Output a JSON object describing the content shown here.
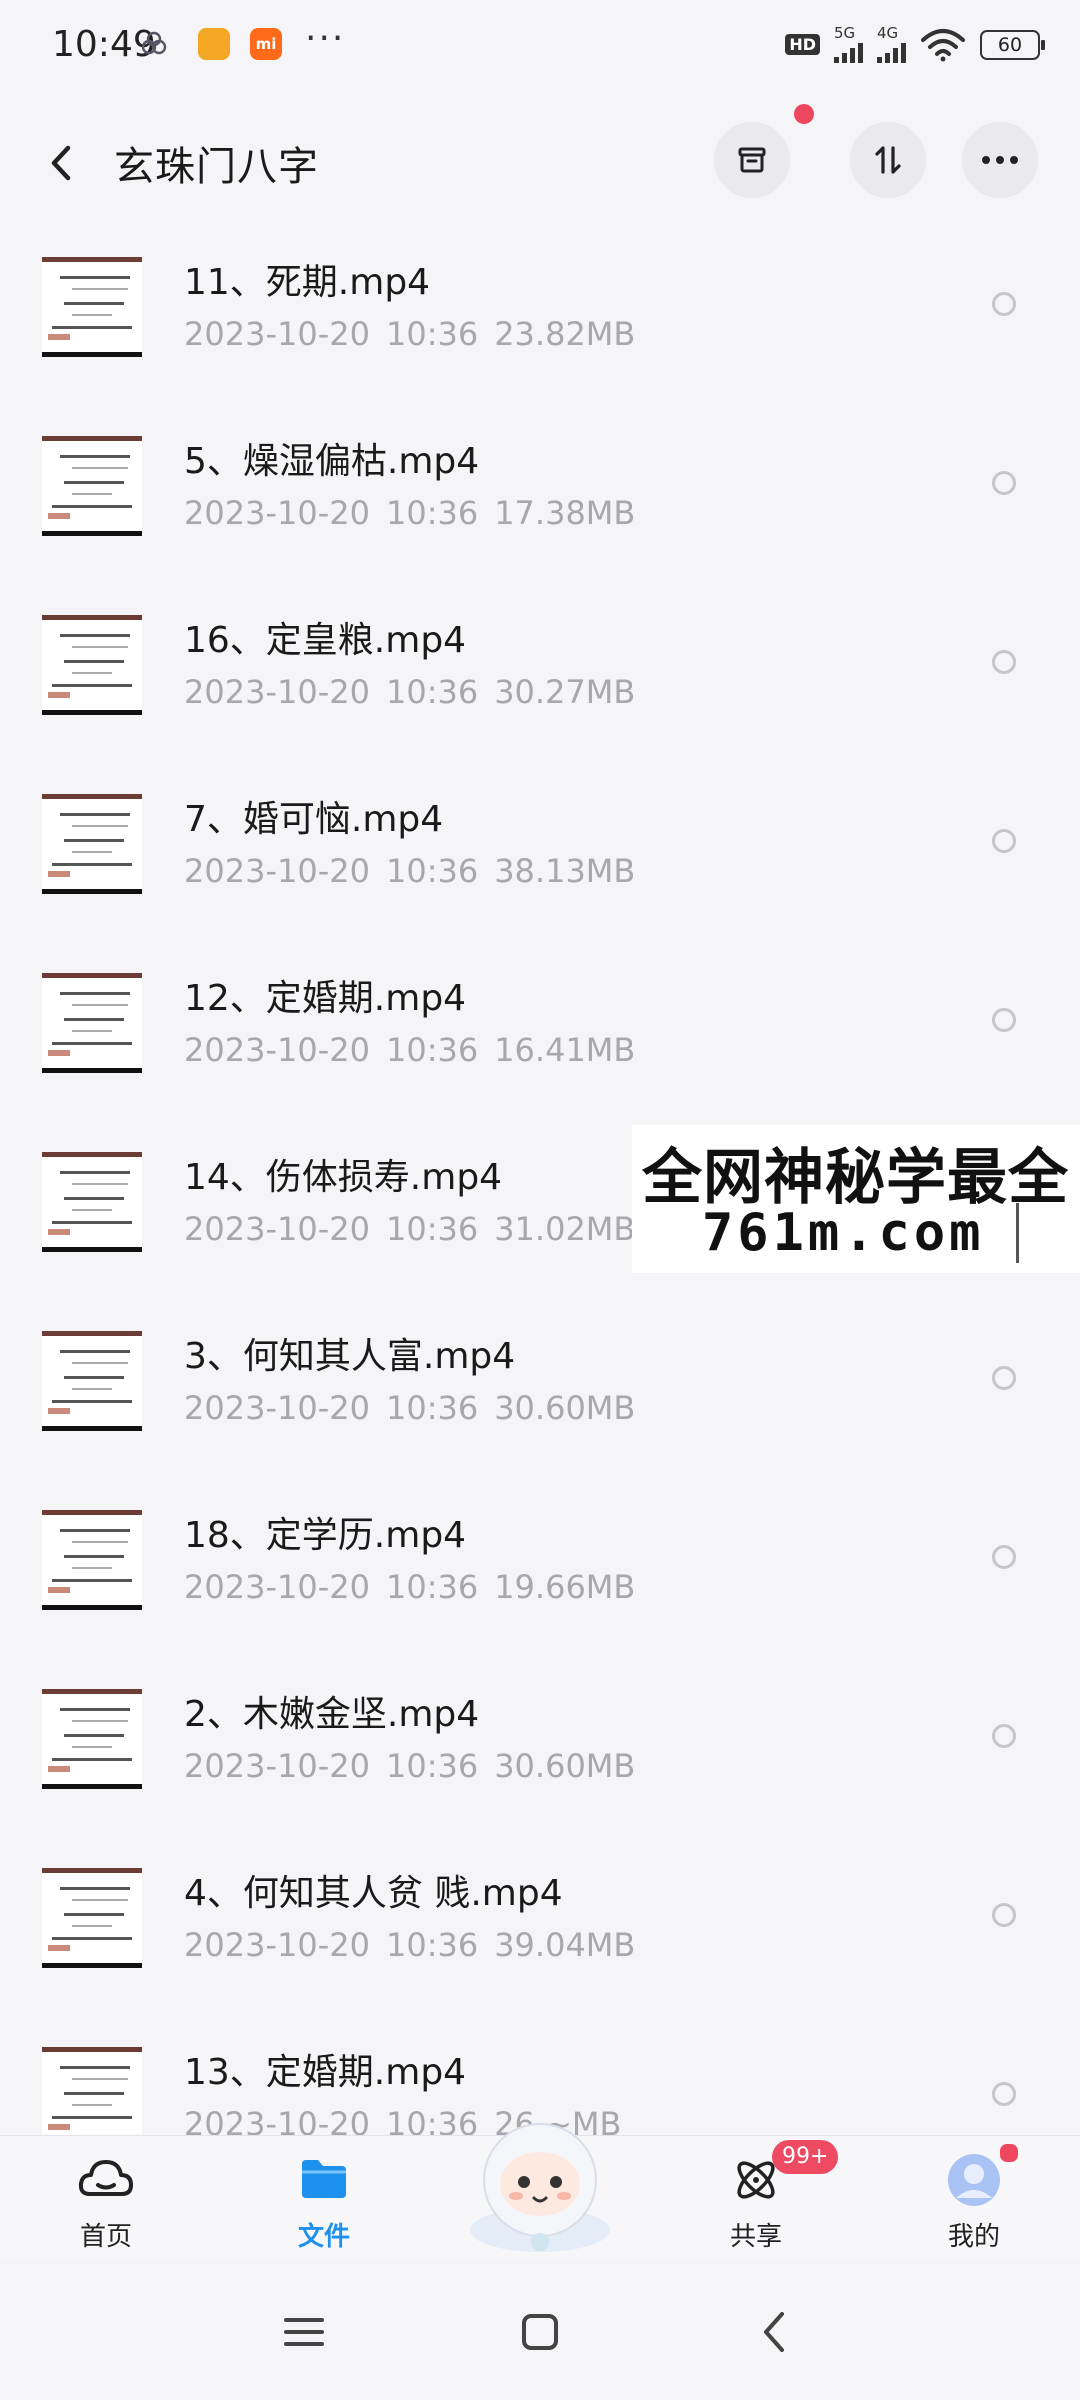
{
  "status_bar": {
    "time": "10:49",
    "hd": "HD",
    "network_1": "5G",
    "network_2": "4G",
    "battery": "60",
    "more": "···"
  },
  "header": {
    "title": "玄珠门八字"
  },
  "files": [
    {
      "name": "11、死期.mp4",
      "date": "2023-10-20",
      "time": "10:36",
      "size": "23.82MB"
    },
    {
      "name": "5、燥湿偏枯.mp4",
      "date": "2023-10-20",
      "time": "10:36",
      "size": "17.38MB"
    },
    {
      "name": "16、定皇粮.mp4",
      "date": "2023-10-20",
      "time": "10:36",
      "size": "30.27MB"
    },
    {
      "name": "7、婚可恼.mp4",
      "date": "2023-10-20",
      "time": "10:36",
      "size": "38.13MB"
    },
    {
      "name": "12、定婚期.mp4",
      "date": "2023-10-20",
      "time": "10:36",
      "size": "16.41MB"
    },
    {
      "name": "14、伤体损寿.mp4",
      "date": "2023-10-20",
      "time": "10:36",
      "size": "31.02MB"
    },
    {
      "name": "3、何知其人富.mp4",
      "date": "2023-10-20",
      "time": "10:36",
      "size": "30.60MB"
    },
    {
      "name": "18、定学历.mp4",
      "date": "2023-10-20",
      "time": "10:36",
      "size": "19.66MB"
    },
    {
      "name": "2、木嫩金坚.mp4",
      "date": "2023-10-20",
      "time": "10:36",
      "size": "30.60MB"
    },
    {
      "name": "4、何知其人贫 贱.mp4",
      "date": "2023-10-20",
      "time": "10:36",
      "size": "39.04MB"
    },
    {
      "name": "13、定婚期.mp4",
      "date": "2023-10-20",
      "time": "10:36",
      "size": "26.~MB"
    }
  ],
  "watermark": {
    "line1": "全网神秘学最全",
    "line2": "761m.com"
  },
  "bottom_nav": {
    "home": "首页",
    "files": "文件",
    "share": "共享",
    "share_badge": "99+",
    "me": "我的"
  },
  "colors": {
    "accent": "#1e90ee",
    "badge": "#ee4b63",
    "meta_text": "#a7a7ac",
    "background": "#f5f5f7"
  }
}
